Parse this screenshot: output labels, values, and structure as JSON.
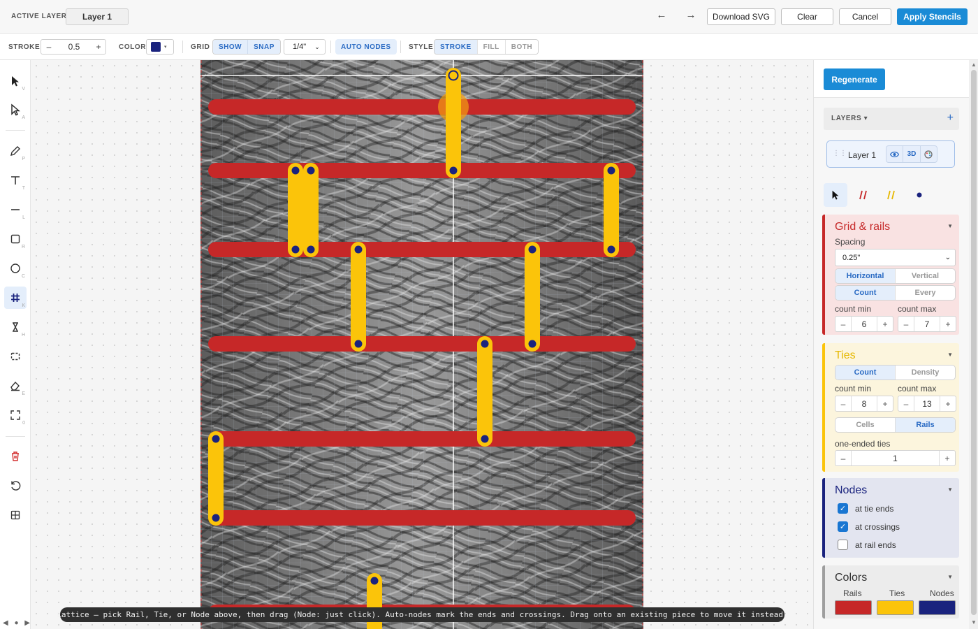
{
  "topbar": {
    "active_layer_label": "ACTIVE LAYER",
    "active_layer_value": "Layer 1",
    "undo_glyph": "←",
    "redo_glyph": "→",
    "download_label": "Download SVG",
    "clear_label": "Clear",
    "cancel_label": "Cancel",
    "apply_label": "Apply Stencils"
  },
  "options": {
    "stroke_label": "STROKE",
    "stroke_minus": "–",
    "stroke_value": "0.5",
    "stroke_plus": "+",
    "color_label": "COLOR",
    "color_value": "#1a237e",
    "grid_label": "GRID",
    "grid_show": "SHOW",
    "grid_snap": "SNAP",
    "grid_size": "1/4\"",
    "auto_nodes": "AUTO NODES",
    "style_label": "STYLE",
    "style_stroke": "STROKE",
    "style_fill": "FILL",
    "style_both": "BOTH"
  },
  "tools": [
    {
      "name": "select",
      "key": "V"
    },
    {
      "name": "direct-select",
      "key": "A"
    },
    {
      "name": "pen",
      "key": "P"
    },
    {
      "name": "text",
      "key": "T"
    },
    {
      "name": "line",
      "key": "L"
    },
    {
      "name": "rectangle",
      "key": "R"
    },
    {
      "name": "ellipse",
      "key": "C"
    },
    {
      "name": "lattice",
      "key": "K"
    },
    {
      "name": "hourglass",
      "key": "H"
    },
    {
      "name": "frame",
      "key": ""
    },
    {
      "name": "eraser",
      "key": "E"
    },
    {
      "name": "fit",
      "key": "0"
    }
  ],
  "status_text": "Lattice — pick Rail, Tie, or Node above, then drag (Node: just click). Auto-nodes mark the ends and crossings. Drag onto an existing piece to move it instead.",
  "mini_nav": "◀ ● ▶",
  "panel": {
    "regenerate_label": "Regenerate",
    "layers_title": "LAYERS ▾",
    "layers_add": "+",
    "layer_name": "Layer 1",
    "layer_3d": "3D",
    "grid_rails": {
      "title": "Grid & rails",
      "spacing_label": "Spacing",
      "spacing_value": "0.25\"",
      "orient_h": "Horizontal",
      "orient_v": "Vertical",
      "mode_count": "Count",
      "mode_every": "Every",
      "count_min_label": "count min",
      "count_min_value": "6",
      "count_max_label": "count max",
      "count_max_value": "7"
    },
    "ties": {
      "title": "Ties",
      "mode_count": "Count",
      "mode_density": "Density",
      "count_min_label": "count min",
      "count_min_value": "8",
      "count_max_label": "count max",
      "count_max_value": "13",
      "scope_cells": "Cells",
      "scope_rails": "Rails",
      "one_ended_label": "one-ended ties",
      "one_ended_value": "1"
    },
    "nodes": {
      "title": "Nodes",
      "at_tie_ends": "at tie ends",
      "at_crossings": "at crossings",
      "at_rail_ends": "at rail ends"
    },
    "colors": {
      "title": "Colors",
      "rails_label": "Rails",
      "ties_label": "Ties",
      "nodes_label": "Nodes",
      "rails_color": "#c62828",
      "ties_color": "#fbc40a",
      "nodes_color": "#1a237e"
    }
  }
}
